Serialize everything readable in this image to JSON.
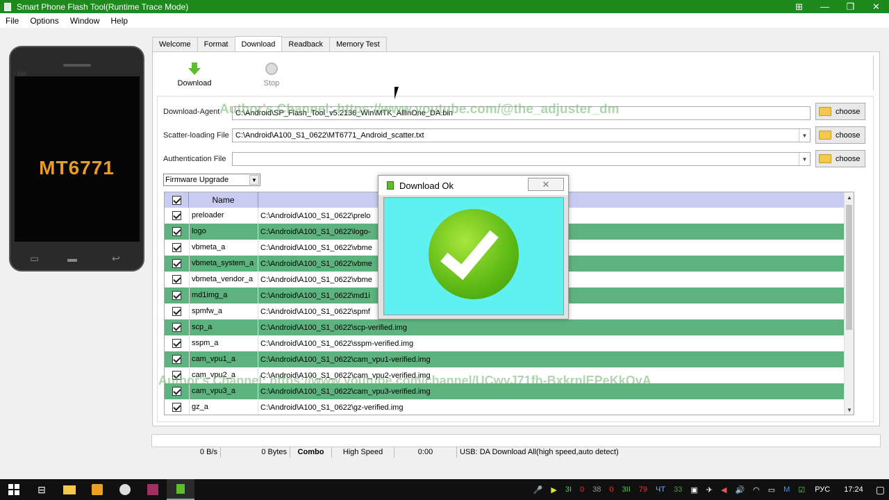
{
  "window": {
    "title": "Smart Phone Flash Tool(Runtime Trace Mode)",
    "buttons": [
      "⊞",
      "—",
      "❐",
      "✕"
    ]
  },
  "menu": [
    "File",
    "Options",
    "Window",
    "Help"
  ],
  "phone": {
    "model": "MT6771",
    "brand": "BM"
  },
  "tabs": [
    "Welcome",
    "Format",
    "Download",
    "Readback",
    "Memory Test"
  ],
  "active_tab": "Download",
  "toolbar": {
    "download_label": "Download",
    "stop_label": "Stop"
  },
  "form": {
    "download_agent_label": "Download-Agent",
    "download_agent_value": "C:\\Android\\SP_Flash_Tool_v5.2136_Win\\MTK_AllInOne_DA.bin",
    "scatter_label": "Scatter-loading File",
    "scatter_value": "C:\\Android\\A100_S1_0622\\MT6771_Android_scatter.txt",
    "auth_label": "Authentication File",
    "auth_value": "",
    "choose_label": "choose",
    "mode": "Firmware Upgrade"
  },
  "table": {
    "header_name": "Name",
    "rows": [
      {
        "name": "preloader",
        "path": "C:\\Android\\A100_S1_0622\\prelo",
        "green": false
      },
      {
        "name": "logo",
        "path": "C:\\Android\\A100_S1_0622\\logo-",
        "green": true
      },
      {
        "name": "vbmeta_a",
        "path": "C:\\Android\\A100_S1_0622\\vbme",
        "green": false
      },
      {
        "name": "vbmeta_system_a",
        "path": "C:\\Android\\A100_S1_0622\\vbme",
        "green": true
      },
      {
        "name": "vbmeta_vendor_a",
        "path": "C:\\Android\\A100_S1_0622\\vbme",
        "green": false
      },
      {
        "name": "md1img_a",
        "path": "C:\\Android\\A100_S1_0622\\md1i",
        "green": true
      },
      {
        "name": "spmfw_a",
        "path": "C:\\Android\\A100_S1_0622\\spmf",
        "green": false
      },
      {
        "name": "scp_a",
        "path": "C:\\Android\\A100_S1_0622\\scp-verified.img",
        "green": true
      },
      {
        "name": "sspm_a",
        "path": "C:\\Android\\A100_S1_0622\\sspm-verified.img",
        "green": false
      },
      {
        "name": "cam_vpu1_a",
        "path": "C:\\Android\\A100_S1_0622\\cam_vpu1-verified.img",
        "green": true
      },
      {
        "name": "cam_vpu2_a",
        "path": "C:\\Android\\A100_S1_0622\\cam_vpu2-verified.img",
        "green": false
      },
      {
        "name": "cam_vpu3_a",
        "path": "C:\\Android\\A100_S1_0622\\cam_vpu3-verified.img",
        "green": true
      },
      {
        "name": "gz_a",
        "path": "C:\\Android\\A100_S1_0622\\gz-verified.img",
        "green": false
      }
    ]
  },
  "watermarks": {
    "top": "Author's Channel: https://www.youtube.com/@the_adjuster_dm",
    "bottom": "Author's Channel: https://www.youtube.com/channel/UCwyJ71fh-BxkrnlEPeKkQvA"
  },
  "dialog": {
    "title": "Download Ok",
    "close": "✕"
  },
  "status": {
    "speed": "0 B/s",
    "bytes": "0 Bytes",
    "combo": "Combo",
    "mode": "High Speed",
    "time": "0:00",
    "usb": "USB: DA Download All(high speed,auto detect)"
  },
  "taskbar": {
    "tray_numbers": [
      "3I",
      "0",
      "38",
      "0",
      "3II",
      "79",
      "ЧТ",
      "33"
    ],
    "language": "РУС",
    "clock": "17:24"
  },
  "colors": {
    "titlebar": "#1e8a1e",
    "row_green": "#5db37e",
    "header": "#c8ccf2",
    "dialog_body": "#5ff0f0"
  }
}
